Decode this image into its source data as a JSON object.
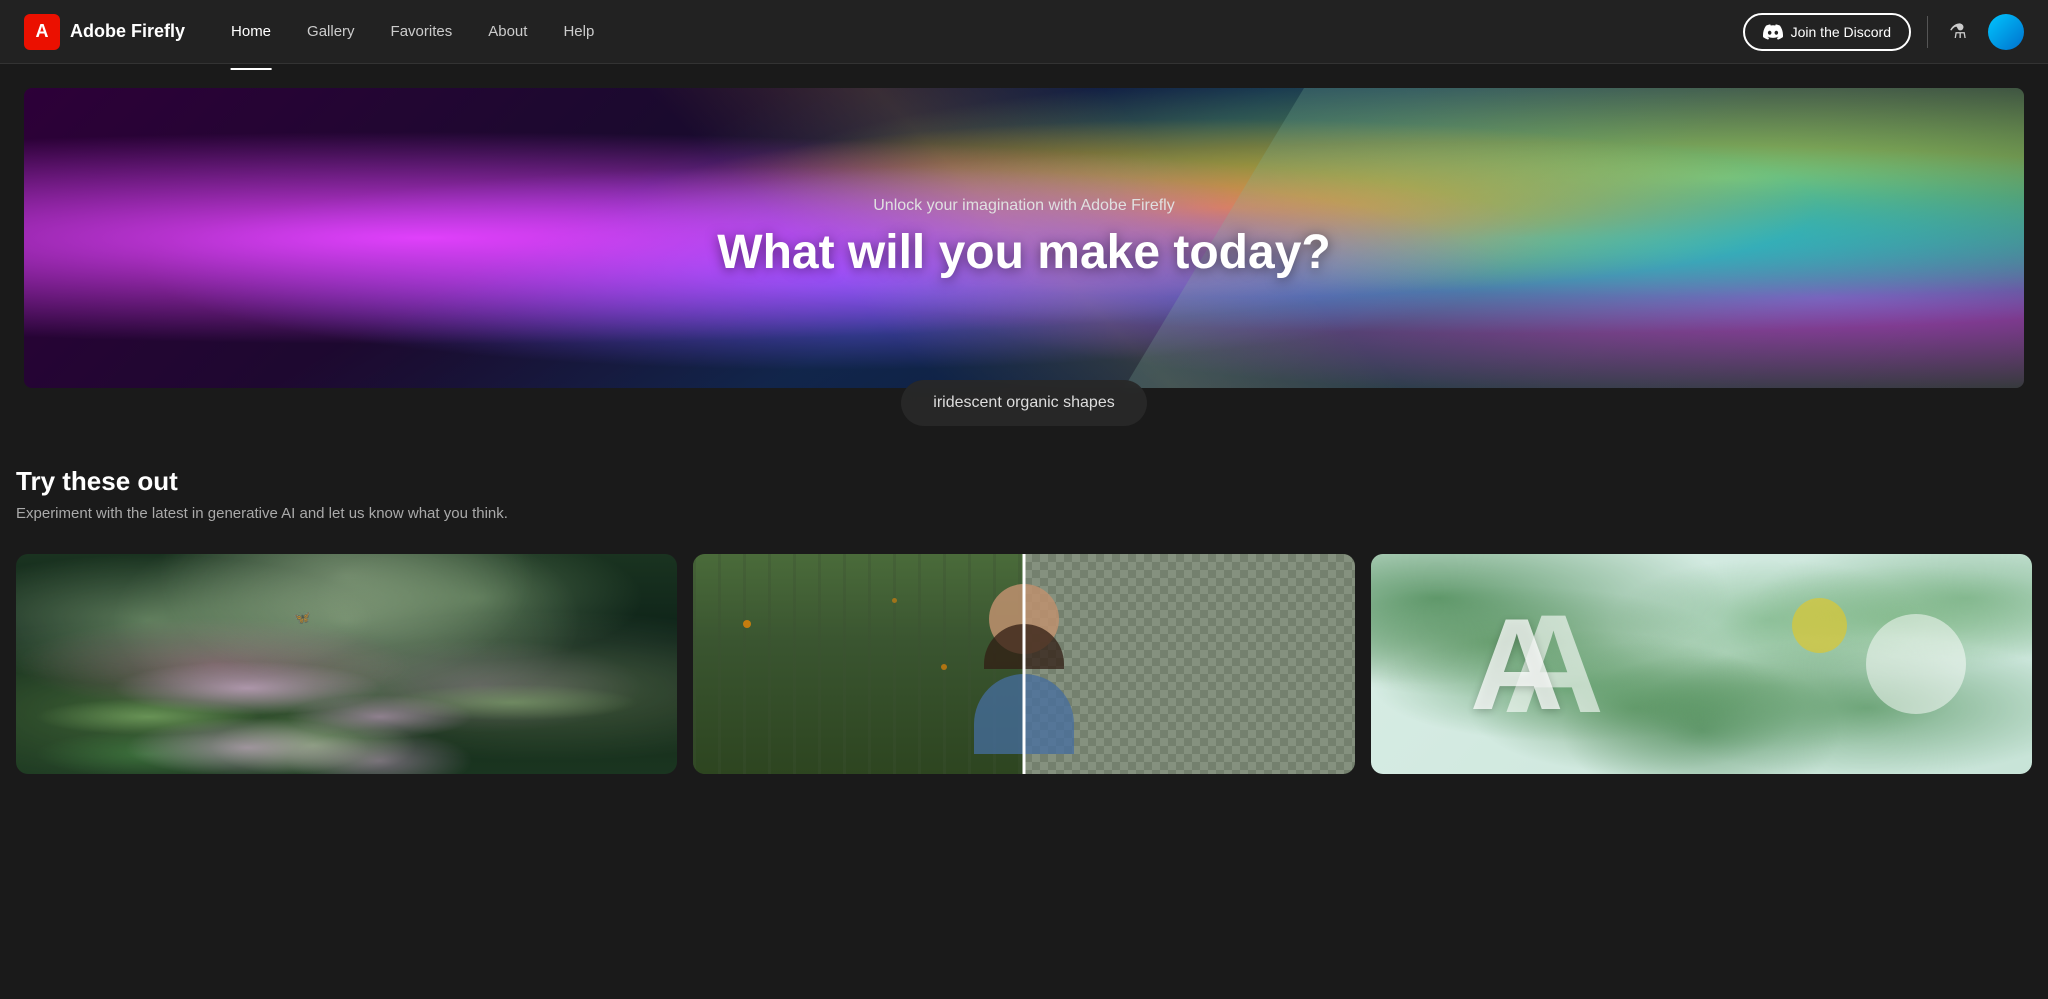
{
  "nav": {
    "brand": "Adobe Firefly",
    "adobe_letter": "A",
    "links": [
      {
        "label": "Home",
        "active": true
      },
      {
        "label": "Gallery",
        "active": false
      },
      {
        "label": "Favorites",
        "active": false
      },
      {
        "label": "About",
        "active": false
      },
      {
        "label": "Help",
        "active": false
      }
    ],
    "discord_button": "Join the Discord",
    "flask_icon": "⚗"
  },
  "hero": {
    "subtitle": "Unlock your imagination with Adobe Firefly",
    "title": "What will you make today?",
    "prompt_text": "iridescent organic shapes"
  },
  "section": {
    "title": "Try these out",
    "description": "Experiment with the latest in generative AI and let us know what you think.",
    "cards": [
      {
        "id": "card-fantasy-forest",
        "alt": "Fantasy forest scene with mushrooms and plants"
      },
      {
        "id": "card-portrait-removal",
        "alt": "Portrait with background removal comparison"
      },
      {
        "id": "card-botanical-letters",
        "alt": "Botanical letter art with tropical leaves"
      }
    ]
  },
  "colors": {
    "brand_red": "#eb1000",
    "bg_dark": "#1a1a1a",
    "nav_bg": "#222222",
    "accent_blue": "#0070cc"
  }
}
